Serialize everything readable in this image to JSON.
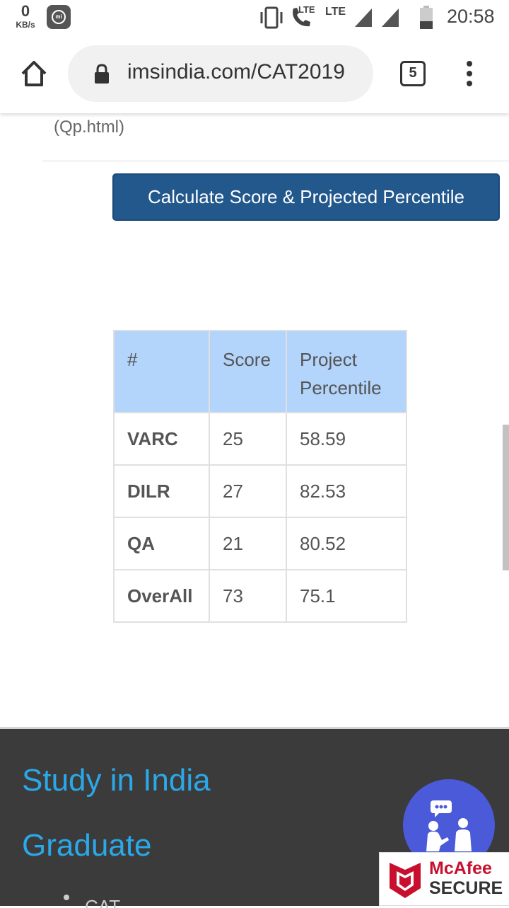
{
  "status_bar": {
    "speed_value": "0",
    "speed_unit": "KB/s",
    "mi_label": "mi",
    "lte_small": "LTE",
    "lte_large": "LTE",
    "time": "20:58"
  },
  "browser": {
    "url": "imsindia.com/CAT2019",
    "tab_count": "5"
  },
  "content": {
    "fragment_text": "(Qp.html)",
    "calc_button_label": "Calculate Score & Projected Percentile",
    "table": {
      "headers": [
        "#",
        "Score",
        "Project Percentile"
      ],
      "rows": [
        {
          "section": "VARC",
          "score": "25",
          "percentile": "58.59"
        },
        {
          "section": "DILR",
          "score": "27",
          "percentile": "82.53"
        },
        {
          "section": "QA",
          "score": "21",
          "percentile": "80.52"
        },
        {
          "section": "OverAll",
          "score": "73",
          "percentile": "75.1"
        }
      ]
    }
  },
  "footer": {
    "link1": "Study in India",
    "link2": "Graduate",
    "sub_item": "CAT",
    "accent_color": "#2aa8e8"
  },
  "mcafee": {
    "line1": "McAfee",
    "line2": "SECURE"
  }
}
